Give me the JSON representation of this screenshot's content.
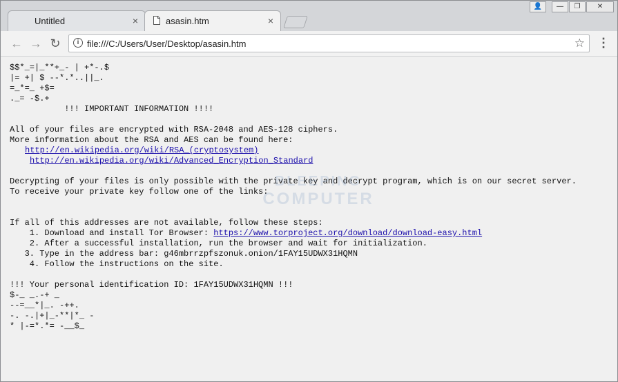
{
  "tabs": [
    {
      "title": "Untitled",
      "close": "×"
    },
    {
      "title": "asasin.htm",
      "close": "×"
    }
  ],
  "window_controls": {
    "user": "👤",
    "minimize": "—",
    "restore": "❐",
    "close": "✕"
  },
  "toolbar": {
    "back": "←",
    "forward": "→",
    "reload": "↻",
    "url": "file:///C:/Users/User/Desktop/asasin.htm",
    "star": "☆",
    "menu": "⋮"
  },
  "content": {
    "ascii_top": [
      "$$*_=|_**+_- | +*-.$",
      "|= +| $ --*.*..||_.",
      "=_*=_ +$=",
      "._= -$.+"
    ],
    "heading": "           !!! IMPORTANT INFORMATION !!!!",
    "p1": [
      "All of your files are encrypted with RSA-2048 and AES-128 ciphers.",
      "More information about the RSA and AES can be found here:"
    ],
    "link1": "http://en.wikipedia.org/wiki/RSA_(cryptosystem)",
    "link2": "http://en.wikipedia.org/wiki/Advanced_Encryption_Standard",
    "p2": [
      "Decrypting of your files is only possible with the private key and decrypt program, which is on our secret server.",
      "To receive your private key follow one of the links:"
    ],
    "p3": "If all of this addresses are not available, follow these steps:",
    "step1_prefix": "    1. Download and install Tor Browser: ",
    "step1_link": "https://www.torproject.org/download/download-easy.html",
    "step2": "    2. After a successful installation, run the browser and wait for initialization.",
    "step3": "   3. Type in the address bar: g46mbrrzpfszonuk.onion/1FAY15UDWX31HQMN",
    "step4": "    4. Follow the instructions on the site.",
    "personal_id": "!!! Your personal identification ID: 1FAY15UDWX31HQMN !!!",
    "ascii_bottom": [
      "$-_ _.-+ _",
      "--=__*|_. -++.",
      "-. -.|+|_-**|*_ -",
      "* |-=*.*= -__$_"
    ]
  }
}
